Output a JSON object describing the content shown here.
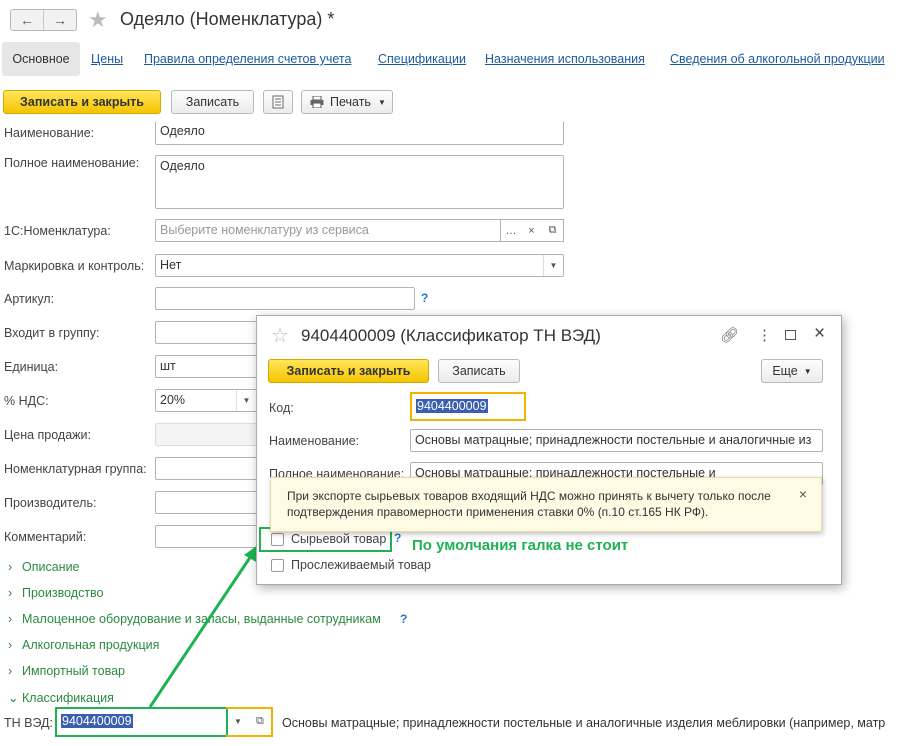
{
  "window": {
    "back_label": "←",
    "forward_label": "→",
    "title": "Одеяло (Номенклатура) *"
  },
  "tabs": [
    "Основное",
    "Цены",
    "Правила определения счетов учета",
    "Спецификации",
    "Назначения использования",
    "Сведения об алкогольной продукции"
  ],
  "toolbar": {
    "save_close": "Записать и закрыть",
    "save": "Записать",
    "print": "Печать"
  },
  "form": {
    "name_label": "Наименование:",
    "name_value": "Одеяло",
    "fullname_label": "Полное наименование:",
    "fullname_value": "Одеяло",
    "nom1c_label": "1С:Номенклатура:",
    "nom1c_placeholder": "Выберите номенклатуру из сервиса",
    "marking_label": "Маркировка и контроль:",
    "marking_value": "Нет",
    "article_label": "Артикул:",
    "group_label": "Входит в группу:",
    "unit_label": "Единица:",
    "unit_value": "шт",
    "vat_label": "% НДС:",
    "vat_value": "20%",
    "price_label": "Цена продажи:",
    "nomgroup_label": "Номенклатурная группа:",
    "producer_label": "Производитель:",
    "comment_label": "Комментарий:",
    "help": "?"
  },
  "groups": [
    {
      "chev": "›",
      "label": "Описание"
    },
    {
      "chev": "›",
      "label": "Производство"
    },
    {
      "chev": "›",
      "label": "Малоценное оборудование и запасы, выданные сотрудникам"
    },
    {
      "chev": "›",
      "label": "Алкогольная продукция"
    },
    {
      "chev": "›",
      "label": "Импортный товар"
    },
    {
      "chev": "⌄",
      "label": "Классификация"
    }
  ],
  "tnved": {
    "label": "ТН ВЭД:",
    "value": "9404400009",
    "description": "Основы матрацные; принадлежности постельные и аналогичные изделия меблировки (например, матр"
  },
  "popup": {
    "title": "9404400009 (Классификатор ТН ВЭД)",
    "save_close": "Записать и закрыть",
    "save": "Записать",
    "more": "Еще",
    "code_label": "Код:",
    "code_value": "9404400009",
    "name_label": "Наименование:",
    "name_value": "Основы матрацные; принадлежности постельные и аналогичные из",
    "fullname_label": "Полное наименование:",
    "fullname_value": "Основы матрацные; принадлежности постельные и",
    "raw_label": "Сырьевой товар",
    "traceable_label": "Прослеживаемый товар"
  },
  "tooltip": {
    "text": "При экспорте сырьевых товаров входящий НДС можно принять к вычету только после подтверждения правомерности применения ставки 0% (п.10 ст.165 НК РФ).",
    "close": "×"
  },
  "annotation": {
    "text": "По умолчания галка не стоит"
  },
  "colors": {
    "accent_yellow": "#f5c400",
    "link_blue": "#1c5a9b",
    "group_green": "#2b8a3e",
    "annotation_green": "#1fb254",
    "highlight_orange": "#f0b400"
  }
}
